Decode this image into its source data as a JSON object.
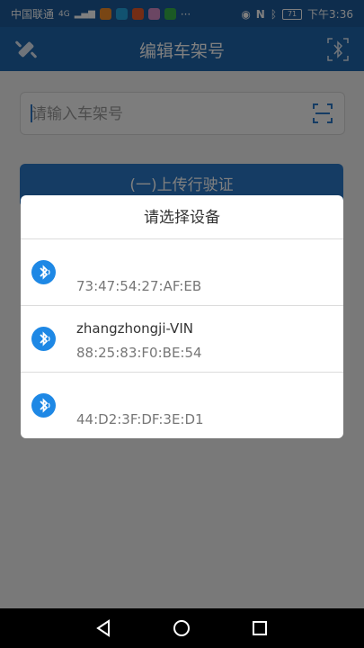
{
  "status_bar": {
    "carrier": "中国联通",
    "signal": "4G",
    "more": "···",
    "battery": "71",
    "time": "下午3:36"
  },
  "app_bar": {
    "title": "编辑车架号",
    "left_icon": "bluetooth-connect-icon",
    "right_icon": "bluetooth-scan-icon"
  },
  "search": {
    "placeholder": "请输入车架号",
    "value": "",
    "scan_icon": "scan-icon"
  },
  "upload_button": {
    "label": "(一)上传行驶证"
  },
  "dialog": {
    "title": "请选择设备",
    "devices": [
      {
        "name": "",
        "mac": "73:47:54:27:AF:EB"
      },
      {
        "name": "zhangzhongji-VIN",
        "mac": "88:25:83:F0:BE:54"
      },
      {
        "name": "",
        "mac": "44:D2:3F:DF:3E:D1"
      }
    ]
  },
  "nav": {
    "back_icon": "back-triangle-icon",
    "home_icon": "home-circle-icon",
    "recents_icon": "recents-square-icon"
  },
  "colors": {
    "primary": "#1f66ad",
    "button": "#2a79c9",
    "bluetooth": "#1e88e5"
  }
}
